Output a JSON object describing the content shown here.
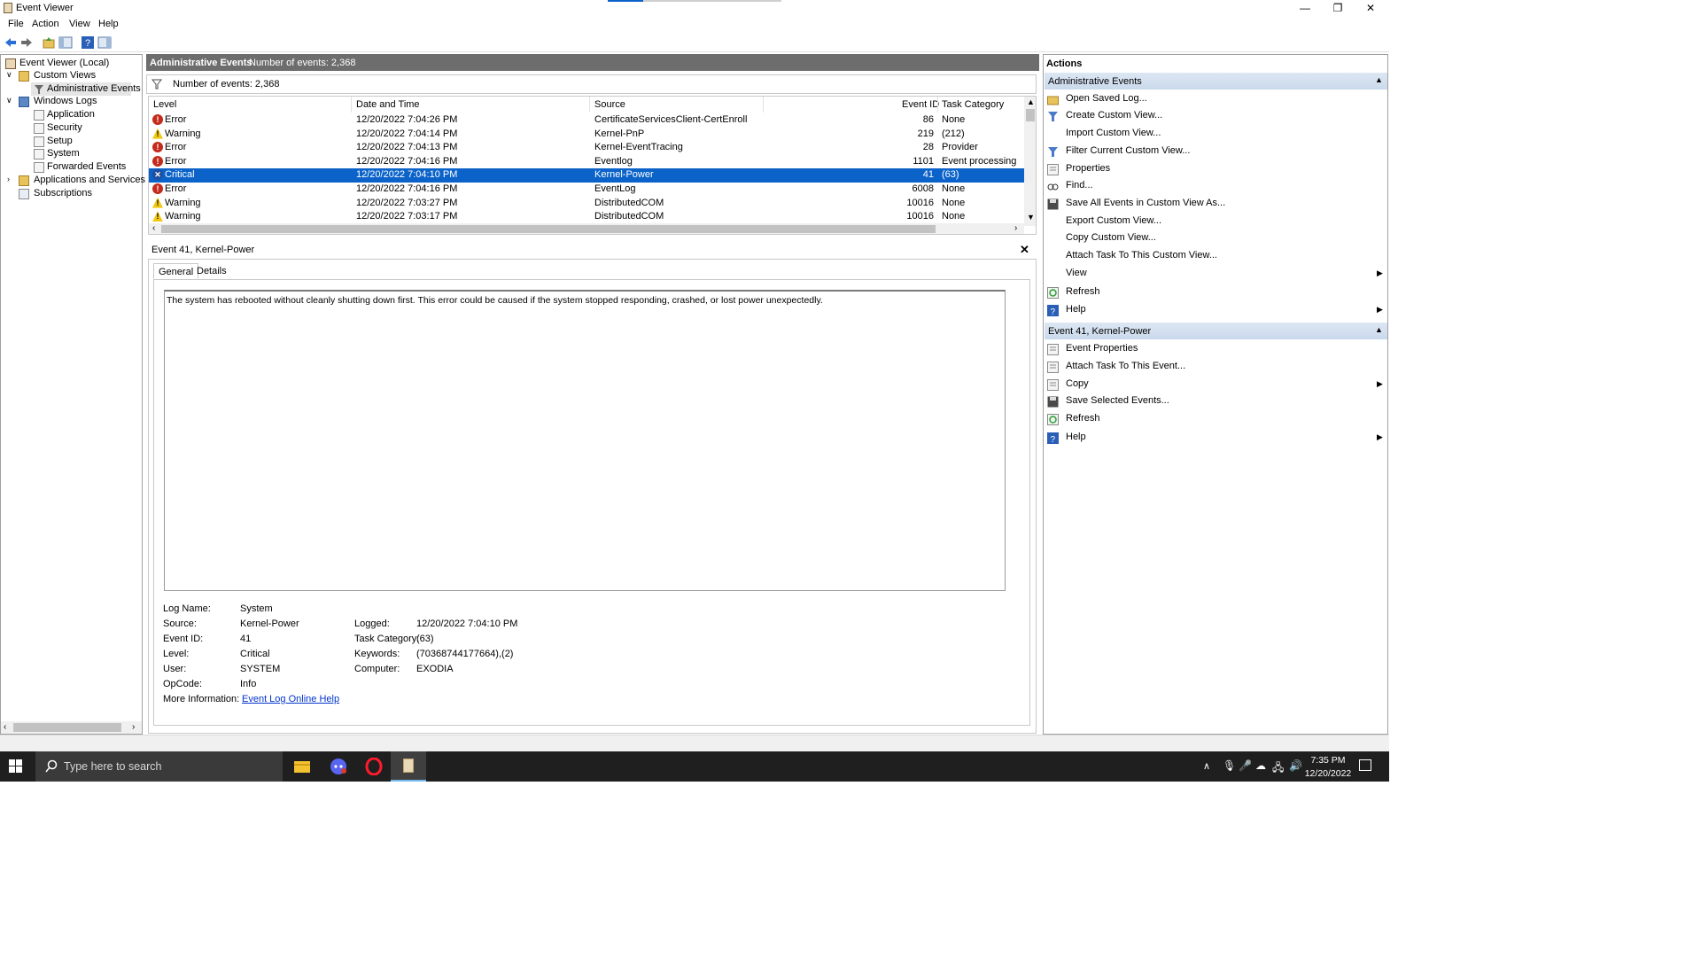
{
  "window": {
    "title": "Event Viewer"
  },
  "menu": [
    "File",
    "Action",
    "View",
    "Help"
  ],
  "tree": {
    "root": "Event Viewer (Local)",
    "custom_views": "Custom Views",
    "admin_events": "Administrative Events",
    "windows_logs": "Windows Logs",
    "logs": [
      "Application",
      "Security",
      "Setup",
      "System",
      "Forwarded Events"
    ],
    "apps_services": "Applications and Services Lo",
    "subscriptions": "Subscriptions"
  },
  "center": {
    "title": "Administrative Events",
    "count_text": "Number of events: 2,368",
    "filter_text": "Number of events: 2,368",
    "columns": [
      "Level",
      "Date and Time",
      "Source",
      "Event ID",
      "Task Category"
    ],
    "rows": [
      {
        "level": "Error",
        "date": "12/20/2022 7:04:26 PM",
        "source": "CertificateServicesClient-CertEnroll",
        "id": "86",
        "cat": "None"
      },
      {
        "level": "Warning",
        "date": "12/20/2022 7:04:14 PM",
        "source": "Kernel-PnP",
        "id": "219",
        "cat": "(212)"
      },
      {
        "level": "Error",
        "date": "12/20/2022 7:04:13 PM",
        "source": "Kernel-EventTracing",
        "id": "28",
        "cat": "Provider"
      },
      {
        "level": "Error",
        "date": "12/20/2022 7:04:16 PM",
        "source": "Eventlog",
        "id": "1101",
        "cat": "Event processing"
      },
      {
        "level": "Critical",
        "date": "12/20/2022 7:04:10 PM",
        "source": "Kernel-Power",
        "id": "41",
        "cat": "(63)"
      },
      {
        "level": "Error",
        "date": "12/20/2022 7:04:16 PM",
        "source": "EventLog",
        "id": "6008",
        "cat": "None"
      },
      {
        "level": "Warning",
        "date": "12/20/2022 7:03:27 PM",
        "source": "DistributedCOM",
        "id": "10016",
        "cat": "None"
      },
      {
        "level": "Warning",
        "date": "12/20/2022 7:03:17 PM",
        "source": "DistributedCOM",
        "id": "10016",
        "cat": "None"
      }
    ]
  },
  "detail": {
    "title": "Event 41, Kernel-Power",
    "tabs": [
      "General",
      "Details"
    ],
    "description": "The system has rebooted without cleanly shutting down first. This error could be caused if the system stopped responding, crashed, or lost power unexpectedly.",
    "fields": {
      "log_name_label": "Log Name:",
      "log_name": "System",
      "source_label": "Source:",
      "source": "Kernel-Power",
      "logged_label": "Logged:",
      "logged": "12/20/2022 7:04:10 PM",
      "event_id_label": "Event ID:",
      "event_id": "41",
      "task_label": "Task Category:",
      "task": "(63)",
      "level_label": "Level:",
      "level": "Critical",
      "keywords_label": "Keywords:",
      "keywords": "(70368744177664),(2)",
      "user_label": "User:",
      "user": "SYSTEM",
      "computer_label": "Computer:",
      "computer": "EXODIA",
      "opcode_label": "OpCode:",
      "opcode": "Info",
      "more_label": "More Information:",
      "more_link": "Event Log Online Help"
    }
  },
  "actions": {
    "header": "Actions",
    "section1": "Administrative Events",
    "items1": [
      "Open Saved Log...",
      "Create Custom View...",
      "Import Custom View...",
      "Filter Current Custom View...",
      "Properties",
      "Find...",
      "Save All Events in Custom View As...",
      "Export Custom View...",
      "Copy Custom View...",
      "Attach Task To This Custom View...",
      "View",
      "Refresh",
      "Help"
    ],
    "section2": "Event 41, Kernel-Power",
    "items2": [
      "Event Properties",
      "Attach Task To This Event...",
      "Copy",
      "Save Selected Events...",
      "Refresh",
      "Help"
    ]
  },
  "taskbar": {
    "search_placeholder": "Type here to search",
    "time": "7:35 PM",
    "date": "12/20/2022"
  },
  "colors": {
    "selection": "#0b63c9",
    "header_gray": "#6d6d6d",
    "taskbar": "#1f1f1f",
    "error": "#c42b1c",
    "warning": "#f2c811",
    "critical": "#1f4e9c"
  }
}
